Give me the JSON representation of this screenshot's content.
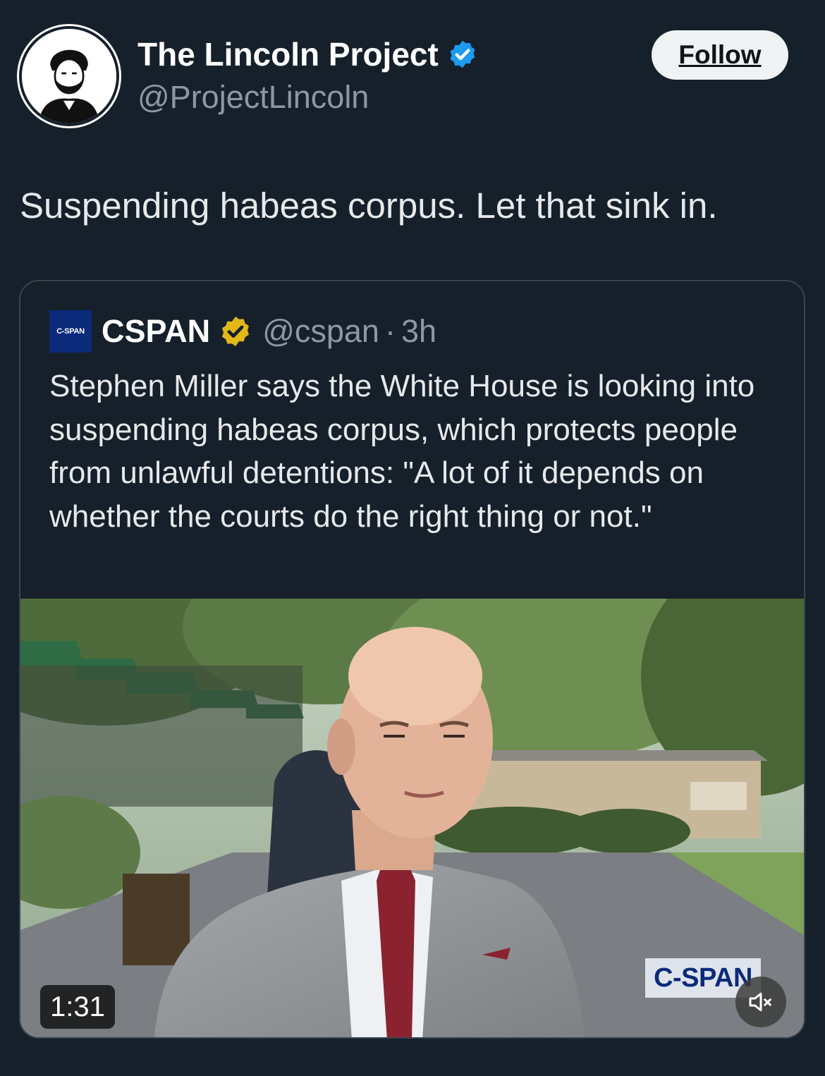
{
  "post": {
    "author_name": "The Lincoln Project",
    "author_handle": "@ProjectLincoln",
    "follow_label": "Follow",
    "text": "Suspending habeas corpus. Let that sink in."
  },
  "quoted_post": {
    "logo_text": "C-SPAN",
    "author_name": "CSPAN",
    "author_handle": "@cspan",
    "separator": "·",
    "time": "3h",
    "text": "Stephen Miller says the White House is looking into suspending habeas corpus, which protects people from unlawful detentions: \"A lot of it depends on whether the courts do the right thing or not.\""
  },
  "video": {
    "duration": "1:31",
    "watermark": "C-SPAN",
    "mute_icon": "speaker-muted-icon"
  },
  "colors": {
    "background": "#15202b",
    "verified_blue": "#1d9bf0",
    "verified_gold": "#e2b719",
    "secondary_text": "#8b98a5"
  }
}
